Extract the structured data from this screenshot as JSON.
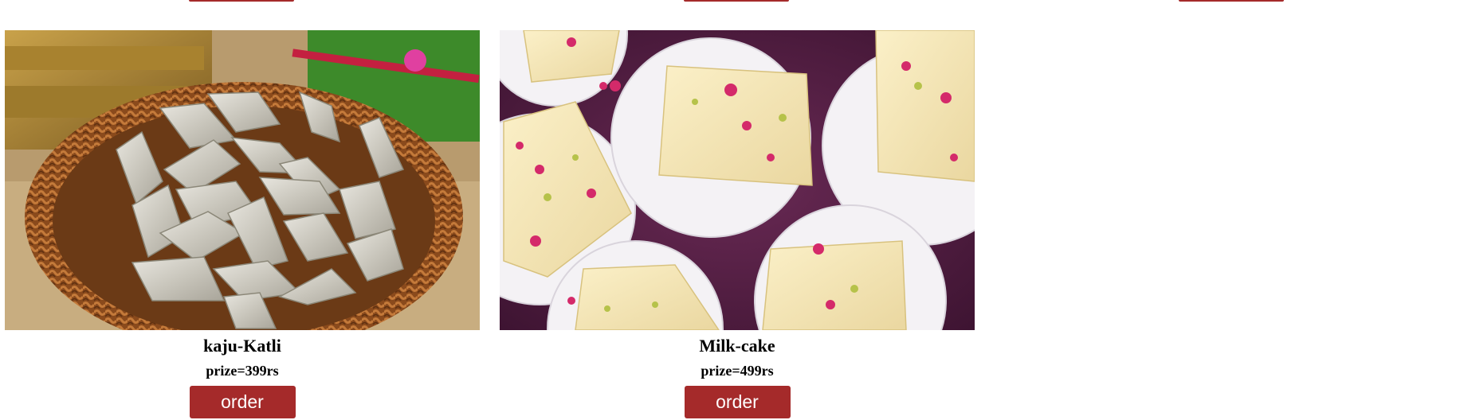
{
  "products": [
    {
      "name": "kaju-Katli",
      "price": "prize=399rs",
      "button": "order"
    },
    {
      "name": "Milk-cake",
      "price": "prize=499rs",
      "button": "order"
    }
  ],
  "colors": {
    "button": "#a52a2a",
    "text": "#000000",
    "background": "#ffffff"
  }
}
